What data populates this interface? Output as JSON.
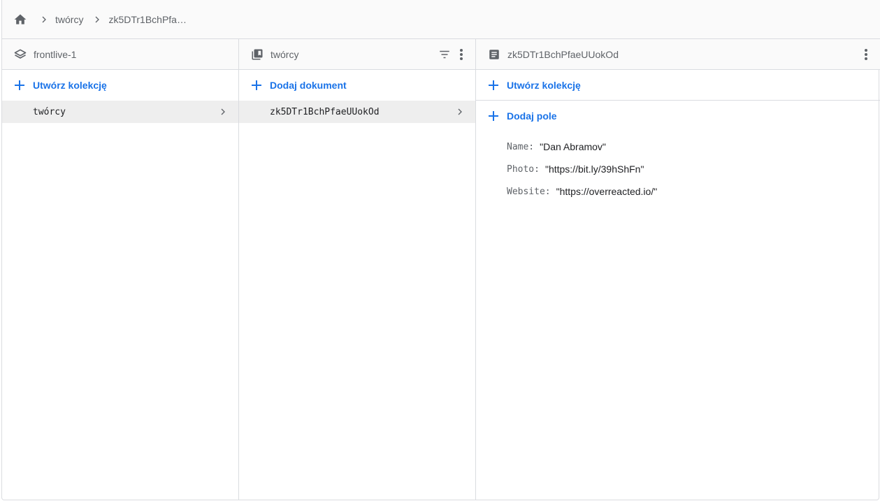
{
  "breadcrumb": {
    "home_icon": "home-icon",
    "items": [
      "twórcy",
      "zk5DTr1BchPfa…"
    ]
  },
  "columns": {
    "project": {
      "title": "frontlive-1",
      "icon": "firestore-layers-icon",
      "action_label": "Utwórz kolekcję",
      "items": [
        "twórcy"
      ]
    },
    "collection": {
      "title": "twórcy",
      "icon": "collection-icon",
      "action_label": "Dodaj dokument",
      "items": [
        "zk5DTr1BchPfaeUUokOd"
      ]
    },
    "document": {
      "title": "zk5DTr1BchPfaeUUokOd",
      "icon": "document-icon",
      "action_label": "Utwórz kolekcję",
      "add_field_label": "Dodaj pole",
      "fields": [
        {
          "key": "Name:",
          "value": "\"Dan Abramov\""
        },
        {
          "key": "Photo:",
          "value": "\"https://bit.ly/39hShFn\""
        },
        {
          "key": "Website:",
          "value": "\"https://overreacted.io/\""
        }
      ]
    }
  },
  "colors": {
    "accent": "#1a73e8",
    "icon": "#5f6368",
    "selected_row": "#eeeeee",
    "header_bg": "#fafafa",
    "border": "#dadce0"
  }
}
